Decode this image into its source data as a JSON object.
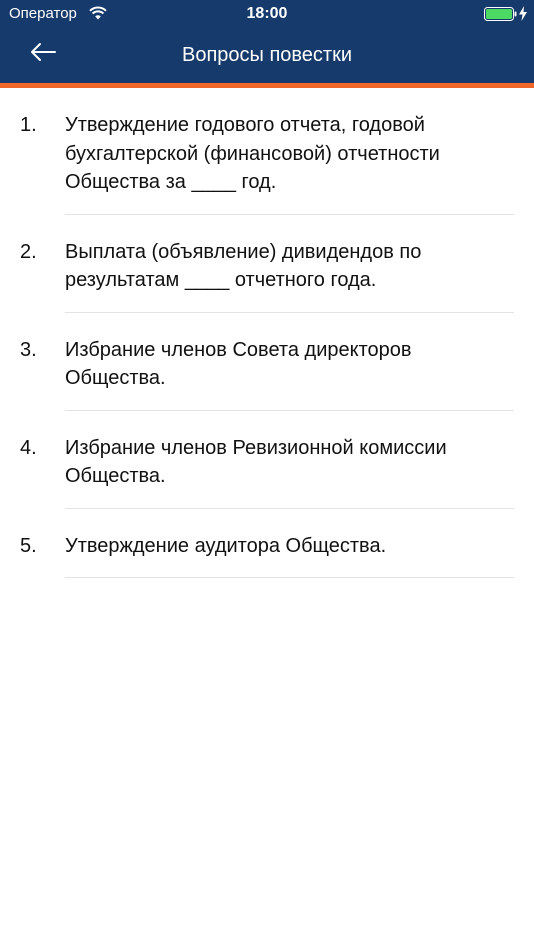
{
  "status_bar": {
    "carrier": "Оператор",
    "time": "18:00"
  },
  "nav": {
    "back_icon": "arrow-left-icon",
    "title": "Вопросы повестки"
  },
  "colors": {
    "header": "#163a6b",
    "accent_bar": "#f2662a",
    "battery": "#4cd964"
  },
  "agenda": {
    "items": [
      {
        "number": "1.",
        "text": "Утверждение годового отчета, годовой бухгалтерской (финансовой) отчетности Общества за ____ год."
      },
      {
        "number": "2.",
        "text": "Выплата (объявление) дивидендов по результатам ____ отчетного года."
      },
      {
        "number": "3.",
        "text": "Избрание членов Совета директоров Общества."
      },
      {
        "number": "4.",
        "text": "Избрание членов Ревизионной комиссии Общества."
      },
      {
        "number": "5.",
        "text": "Утверждение аудитора Общества."
      }
    ]
  }
}
